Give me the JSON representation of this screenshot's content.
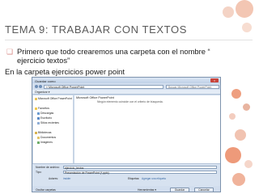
{
  "slide": {
    "title": "TEMA 9: TRABAJAR CON TEXTOS",
    "bullet": "Primero que todo crearemos una carpeta con el nombre “ ejercicio textos”",
    "line2": "En la carpeta ejercicios power point"
  },
  "dialog": {
    "title": "Guardar como",
    "path": "« Microsoft Office PowerPoint",
    "search_placeholder": "Buscar Microsoft Office PowerPoint",
    "organize": "Organizar ▾",
    "location_label": "Microsoft Office PowerPoint",
    "empty_message": "Ningún elemento coincide con el criterio de búsqueda.",
    "nav_items": [
      {
        "label": "Microsoft Office PowerPoint",
        "icon": "folder-icon"
      },
      {
        "label": "Favoritos",
        "icon": "star-icon"
      },
      {
        "label": "Descargas",
        "icon": "download-icon"
      },
      {
        "label": "Escritorio",
        "icon": "desktop-icon"
      },
      {
        "label": "Sitios recientes",
        "icon": "recent-icon"
      },
      {
        "label": "Bibliotecas",
        "icon": "library-icon"
      },
      {
        "label": "Documentos",
        "icon": "documents-icon"
      },
      {
        "label": "Imágenes",
        "icon": "pictures-icon"
      }
    ],
    "filename_label": "Nombre de archivo:",
    "filename_value": "ejercicio_textos",
    "type_label": "Tipo:",
    "type_value": "Presentación de PowerPoint (*.pptx)",
    "authors_label": "Autores:",
    "authors_value": "insider",
    "tags_label": "Etiquetas:",
    "tags_value": "Agregar una etiqueta",
    "hide_folders": "Ocultar carpetas",
    "tools": "Herramientas ▾",
    "save": "Guardar",
    "cancel": "Cancelar"
  }
}
